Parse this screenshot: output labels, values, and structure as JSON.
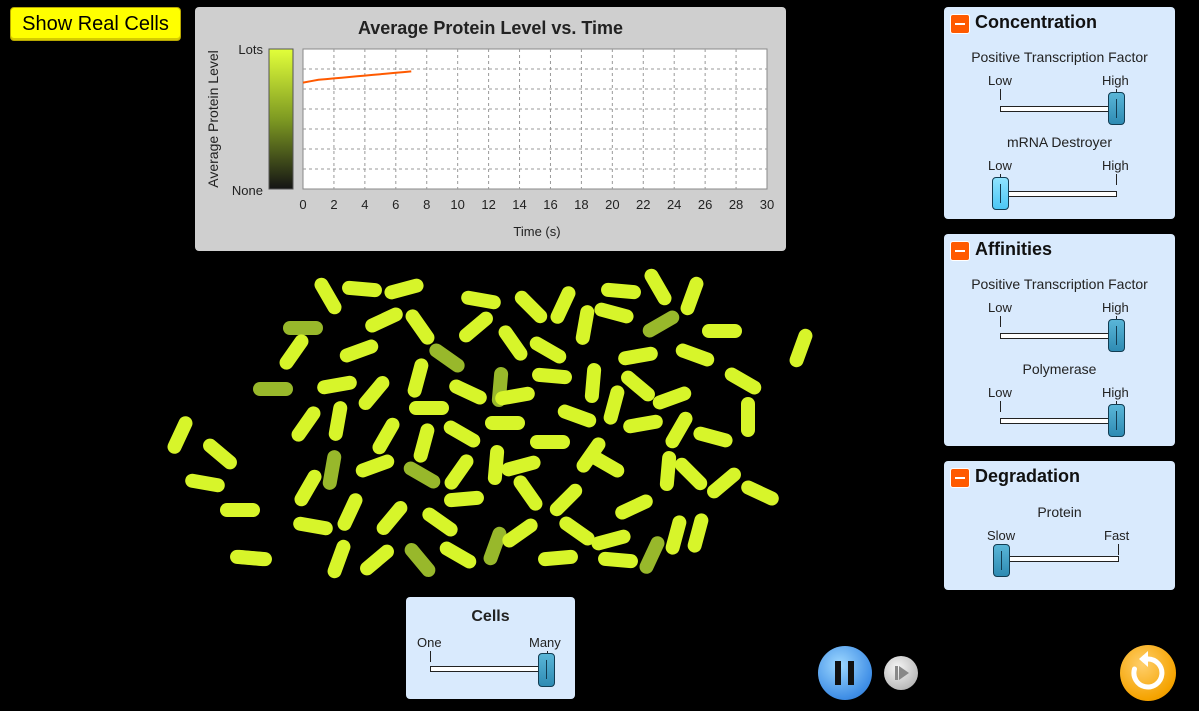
{
  "buttons": {
    "show_real_cells": "Show Real Cells"
  },
  "chart_data": {
    "type": "line",
    "title": "Average Protein Level vs. Time",
    "xlabel": "Time (s)",
    "ylabel": "Average Protein Level",
    "xlim": [
      0,
      30
    ],
    "x_ticks": [
      "0",
      "2",
      "4",
      "6",
      "8",
      "10",
      "12",
      "14",
      "16",
      "18",
      "20",
      "22",
      "24",
      "26",
      "28",
      "30"
    ],
    "y_top_label": "Lots",
    "y_bottom_label": "None",
    "ylim": [
      0,
      1
    ],
    "grid": true,
    "series": [
      {
        "color": "#ff5a00",
        "x": [
          0,
          0.5,
          1,
          1.5,
          2,
          2.5,
          3,
          3.5,
          4,
          4.5,
          5,
          5.5,
          6,
          6.5,
          7
        ],
        "y": [
          0.76,
          0.77,
          0.78,
          0.785,
          0.79,
          0.795,
          0.8,
          0.805,
          0.81,
          0.815,
          0.82,
          0.825,
          0.83,
          0.835,
          0.84
        ]
      }
    ]
  },
  "panels": {
    "concentration": {
      "title": "Concentration",
      "controls": [
        {
          "label": "Positive Transcription Factor",
          "min_label": "Low",
          "max_label": "High",
          "value": 1.0
        },
        {
          "label": "mRNA Destroyer",
          "min_label": "Low",
          "max_label": "High",
          "value": 0.0
        }
      ]
    },
    "affinities": {
      "title": "Affinities",
      "controls": [
        {
          "label": "Positive Transcription Factor",
          "min_label": "Low",
          "max_label": "High",
          "value": 1.0
        },
        {
          "label": "Polymerase",
          "min_label": "Low",
          "max_label": "High",
          "value": 1.0
        }
      ]
    },
    "degradation": {
      "title": "Degradation",
      "controls": [
        {
          "label": "Protein",
          "min_label": "Slow",
          "max_label": "Fast",
          "value": 0.0
        }
      ]
    },
    "cells": {
      "title": "Cells",
      "min_label": "One",
      "max_label": "Many",
      "value": 1.0
    }
  },
  "colors": {
    "cell_bright": "#d7f52a",
    "cell_dim": "#98b82b",
    "accent_orange": "#ff5a00",
    "panel_bg": "#d9eafd"
  },
  "icons": {
    "pause": "pause-icon",
    "step": "step-forward-icon",
    "reset": "reset-icon"
  }
}
